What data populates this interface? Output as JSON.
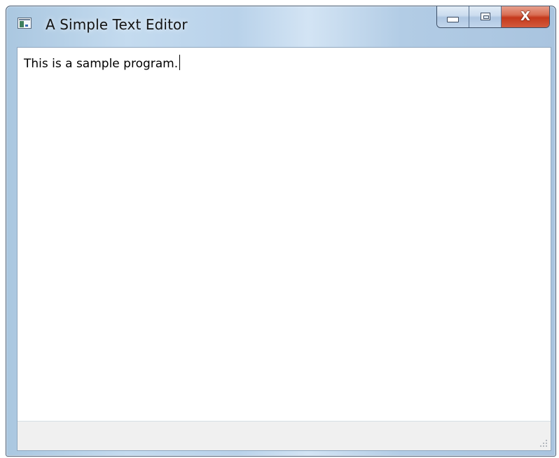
{
  "window": {
    "title": "A Simple Text Editor",
    "icons": {
      "app": "application-window-icon",
      "minimize": "minimize-icon",
      "maximize": "maximize-icon",
      "close": "close-icon",
      "grip": "size-grip-icon"
    },
    "close_glyph": "X"
  },
  "editor": {
    "text": "This is a sample program."
  },
  "colors": {
    "title_bar": "#b9d2ea",
    "close_button": "#c4391c",
    "status_bar": "#f0f0f0"
  }
}
